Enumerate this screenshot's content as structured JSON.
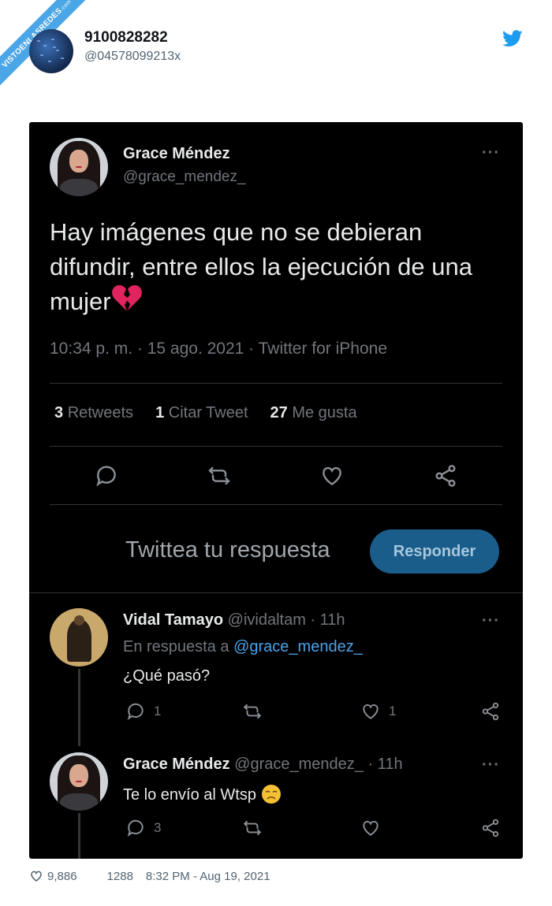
{
  "watermark": {
    "line1": "VISTOENLASREDES",
    "line2": ".com"
  },
  "embed": {
    "name": "9100828282",
    "handle": "@04578099213x",
    "icon": "twitter-bird-icon",
    "brand_color": "#1d9bf0"
  },
  "tweet": {
    "author_name": "Grace Méndez",
    "author_handle": "@grace_mendez_",
    "more": "···",
    "text": "Hay imágenes que no se debieran difundir, entre ellos la ejecución de una mujer",
    "emoji": "broken-heart-icon",
    "meta": "10:34 p. m. · 15 ago. 2021 · Twitter for iPhone",
    "stats": {
      "retweets_count": "3",
      "retweets_label": "Retweets",
      "quotes_count": "1",
      "quotes_label": "Citar Tweet",
      "likes_count": "27",
      "likes_label": "Me gusta"
    },
    "reply_placeholder": "Twittea tu respuesta",
    "reply_button": "Responder"
  },
  "replies": [
    {
      "name": "Vidal Tamayo",
      "handle_time": "@ividaltam · 11h",
      "in_reply_prefix": "En respuesta a",
      "in_reply_mention": "@grace_mendez_",
      "text": "¿Qué pasó?",
      "reply_count": "1",
      "like_count": "1"
    },
    {
      "name": "Grace Méndez",
      "handle_time": "@grace_mendez_ · 11h",
      "text": "Te lo envío al Wtsp",
      "emoji": "disappointed-face-icon",
      "reply_count": "3"
    }
  ],
  "footer": {
    "likes": "9,886",
    "second_count": "1288",
    "timestamp": "8:32 PM - Aug 19, 2021"
  },
  "colors": {
    "background_dark": "#000000",
    "accent_blue": "#1a5d8b",
    "mention_blue": "#4aa3e8",
    "muted": "#71767b"
  }
}
